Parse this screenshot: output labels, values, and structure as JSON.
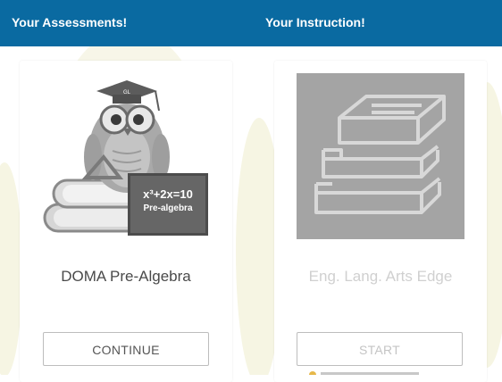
{
  "header": {
    "assessments_title": "Your Assessments!",
    "instruction_title": "Your Instruction!"
  },
  "assessment_card": {
    "name": "DOMA Pre-Algebra",
    "board_line1": "x³+2x=10",
    "board_line2": "Pre-algebra",
    "cap_badge": "GL",
    "button_label": "CONTINUE"
  },
  "instruction_card": {
    "name": "Eng. Lang. Arts Edge",
    "button_label": "START",
    "icon": "books-stack-icon"
  },
  "colors": {
    "header_bg": "#0a6aa1",
    "header_text": "#ffffff",
    "card_title_active": "#4a4a4a",
    "card_title_disabled": "#d0d0d0",
    "thumbnail_gray": "#a4a4a4"
  }
}
